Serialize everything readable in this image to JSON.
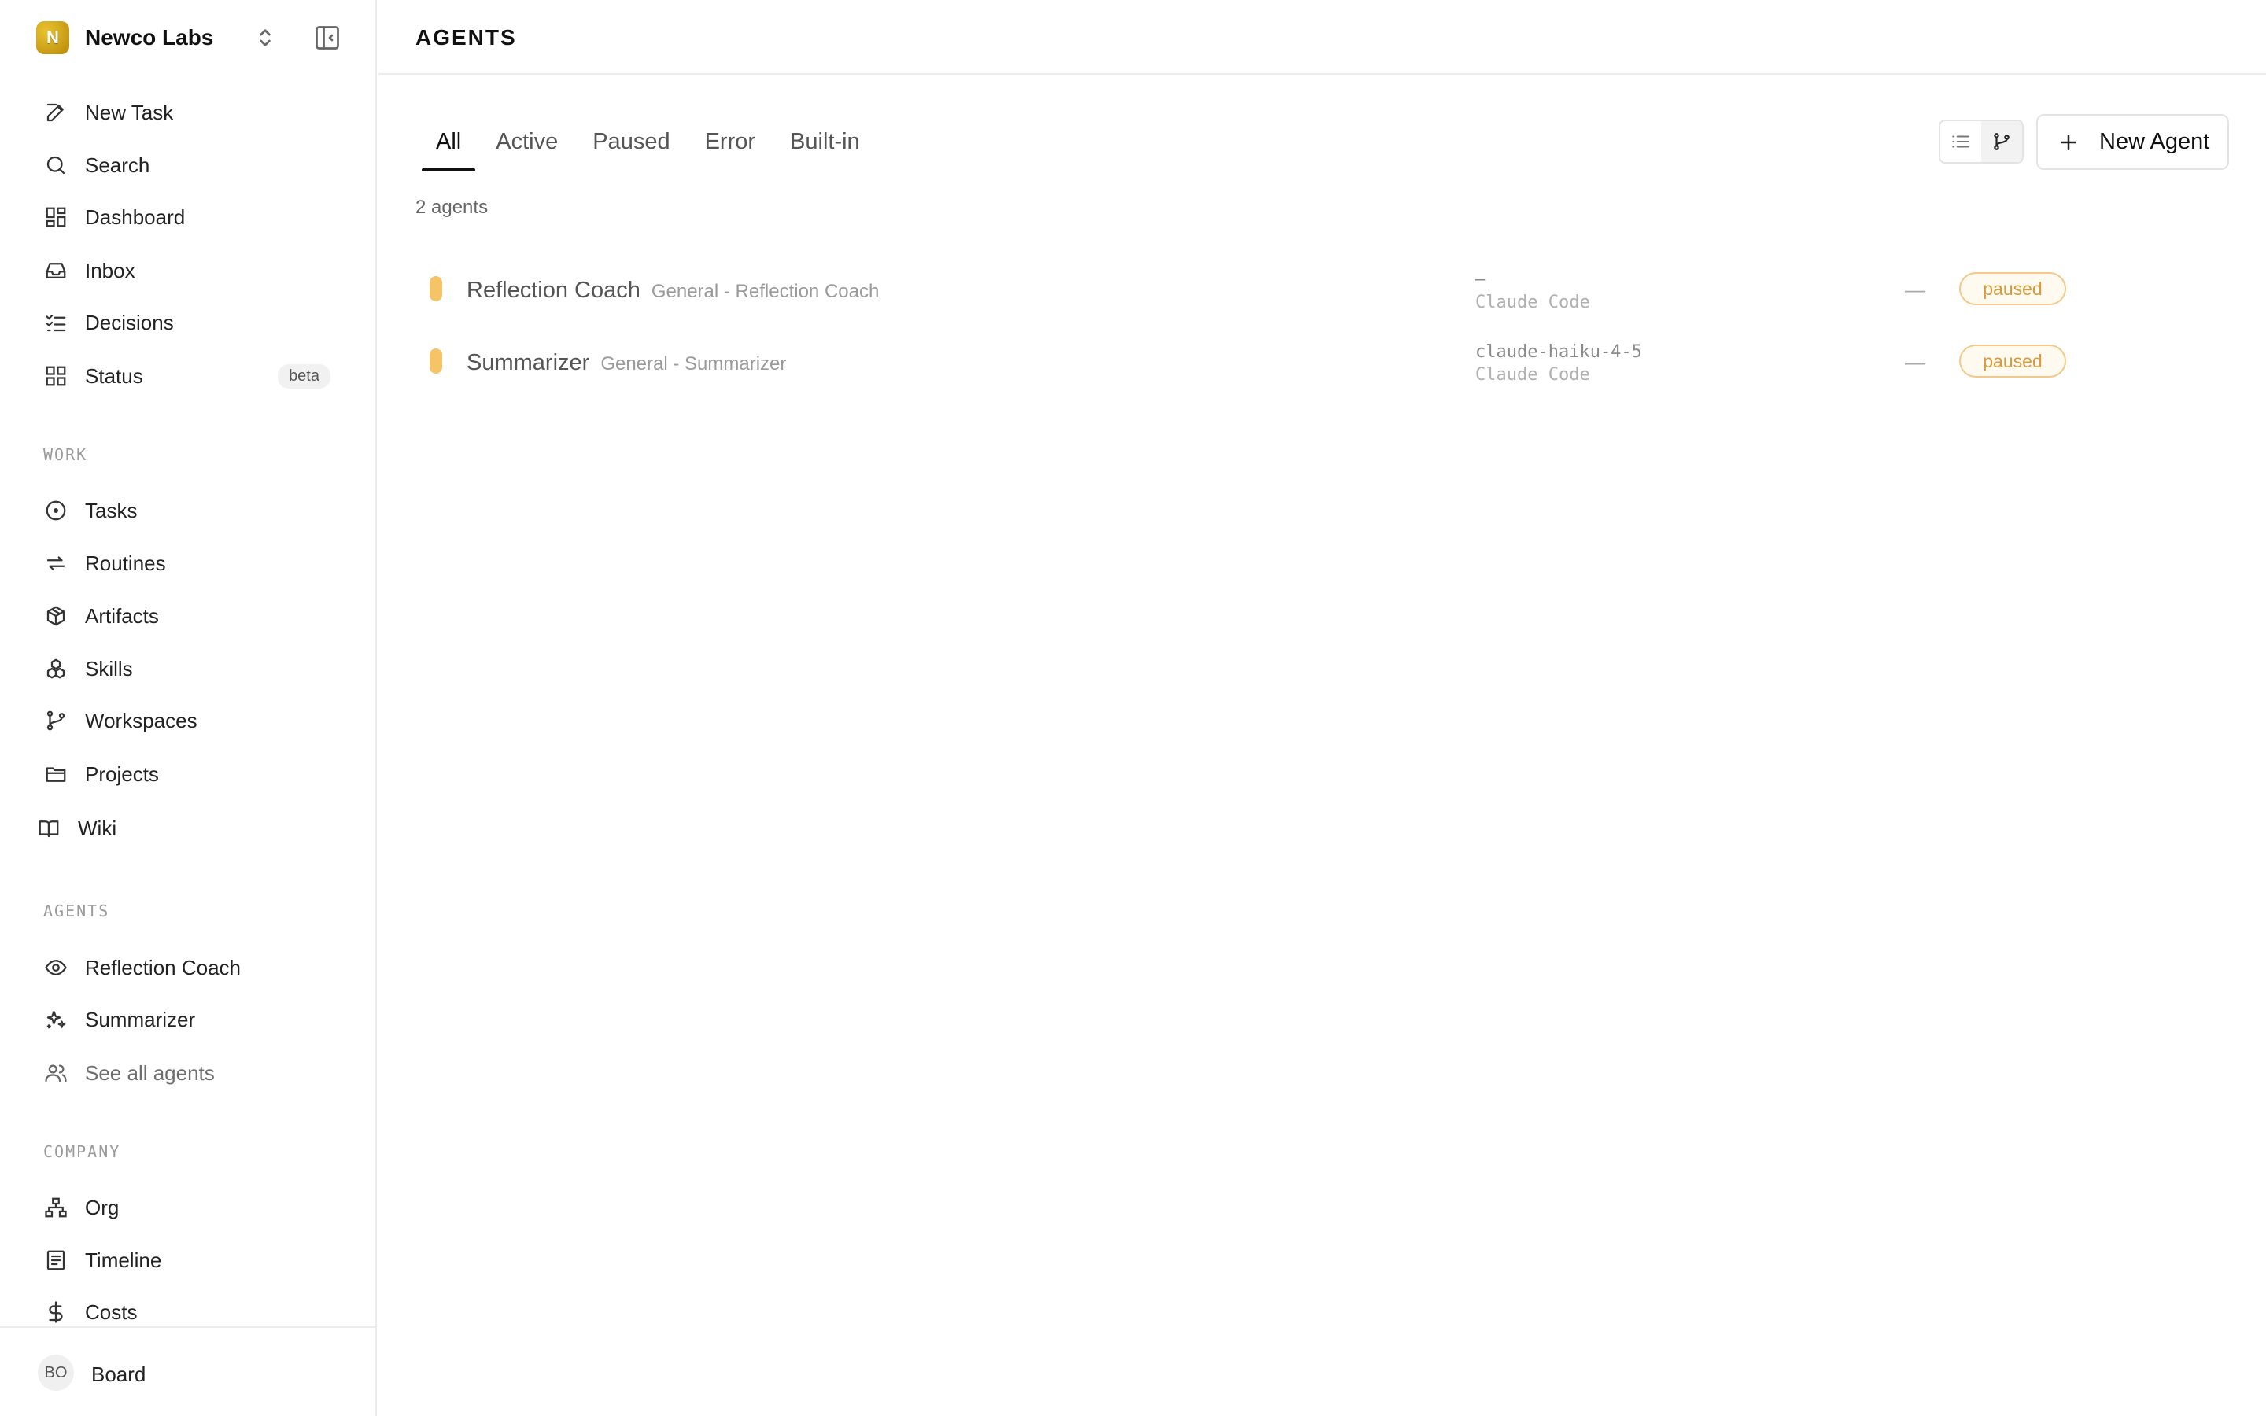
{
  "workspace": {
    "initial": "N",
    "name": "Newco Labs"
  },
  "nav": {
    "primary": [
      {
        "label": "New Task",
        "icon": "edit-icon"
      },
      {
        "label": "Search",
        "icon": "search-icon"
      },
      {
        "label": "Dashboard",
        "icon": "dashboard-icon"
      },
      {
        "label": "Inbox",
        "icon": "inbox-icon"
      },
      {
        "label": "Decisions",
        "icon": "list-check-icon"
      },
      {
        "label": "Status",
        "icon": "grid-icon",
        "badge": "beta"
      }
    ],
    "work_title": "WORK",
    "work": [
      {
        "label": "Tasks",
        "icon": "circle-dot-icon"
      },
      {
        "label": "Routines",
        "icon": "repeat-icon"
      },
      {
        "label": "Artifacts",
        "icon": "package-icon"
      },
      {
        "label": "Skills",
        "icon": "skills-icon"
      },
      {
        "label": "Workspaces",
        "icon": "git-branch-icon"
      },
      {
        "label": "Projects",
        "icon": "folder-icon"
      },
      {
        "label": "Wiki",
        "icon": "book-icon"
      }
    ],
    "agents_title": "AGENTS",
    "agents": [
      {
        "label": "Reflection Coach",
        "icon": "eye-icon"
      },
      {
        "label": "Summarizer",
        "icon": "sparkles-icon"
      },
      {
        "label": "See all agents",
        "icon": "users-icon"
      }
    ],
    "company_title": "COMPANY",
    "company": [
      {
        "label": "Org",
        "icon": "org-chart-icon"
      },
      {
        "label": "Timeline",
        "icon": "timeline-icon"
      },
      {
        "label": "Costs",
        "icon": "dollar-icon"
      }
    ]
  },
  "footer": {
    "avatar": "BO",
    "label": "Board"
  },
  "main": {
    "title": "AGENTS",
    "tabs": [
      "All",
      "Active",
      "Paused",
      "Error",
      "Built-in"
    ],
    "active_tab": "All",
    "count_label": "2 agents",
    "new_agent_label": "New Agent",
    "agents": [
      {
        "name": "Reflection Coach",
        "role": "General - Reflection Coach",
        "model": "–",
        "runtime": "Claude Code",
        "last": "—",
        "status": "paused"
      },
      {
        "name": "Summarizer",
        "role": "General - Summarizer",
        "model": "claude-haiku-4-5",
        "runtime": "Claude Code",
        "last": "—",
        "status": "paused"
      }
    ]
  },
  "colors": {
    "accent": "#111111",
    "status_paused_text": "#d89a3a",
    "status_paused_border": "#f1c98a",
    "agent_dot": "#f4c467",
    "logo": "#d4a514"
  }
}
